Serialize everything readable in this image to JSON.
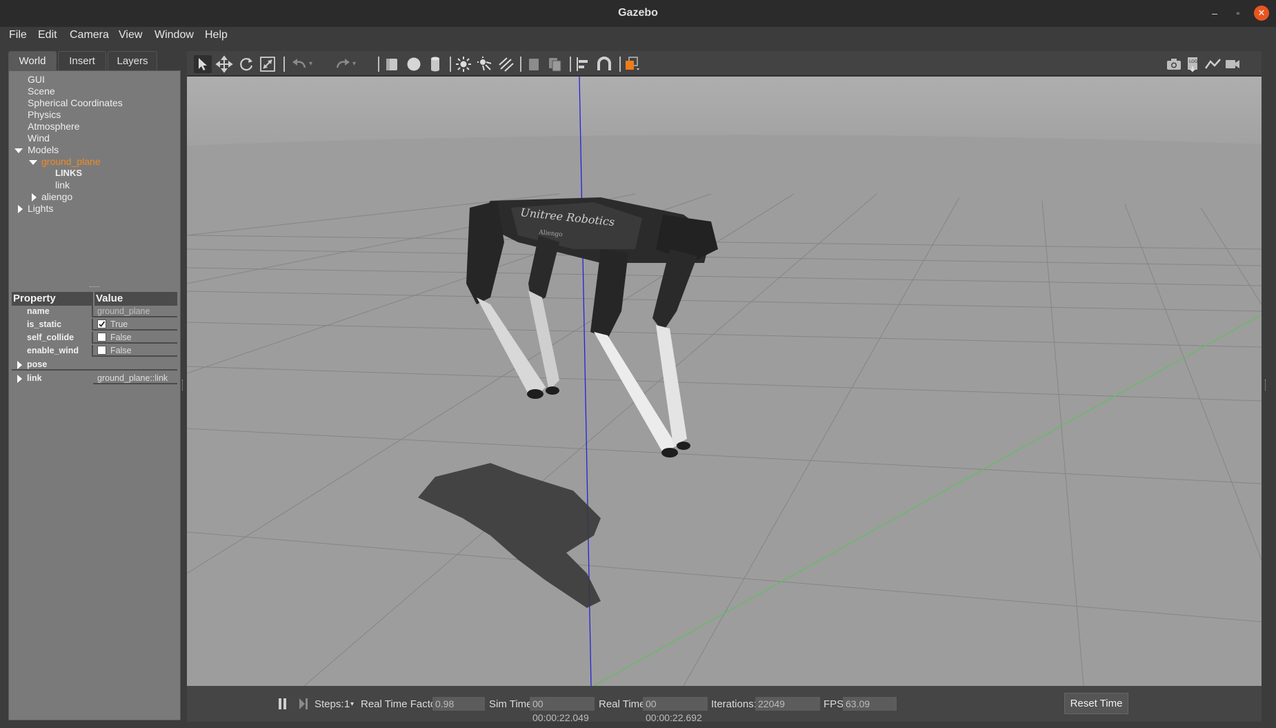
{
  "window": {
    "title": "Gazebo",
    "min_label": "–",
    "max_label": "▫",
    "close_label": "✕",
    "accent": "#e95420"
  },
  "menu": [
    "File",
    "Edit",
    "Camera",
    "View",
    "Window",
    "Help"
  ],
  "tabs": [
    "World",
    "Insert",
    "Layers"
  ],
  "tree": {
    "gui": "GUI",
    "scene": "Scene",
    "spherical": "Spherical Coordinates",
    "physics": "Physics",
    "atmosphere": "Atmosphere",
    "wind": "Wind",
    "models": "Models",
    "ground_plane": "ground_plane",
    "links_header": "LINKS",
    "link": "link",
    "aliengo": "aliengo",
    "lights": "Lights",
    "selected_color": "#f08a24"
  },
  "properties": {
    "header_property": "Property",
    "header_value": "Value",
    "rows": [
      {
        "name": "name",
        "value": "ground_plane"
      },
      {
        "name": "is_static",
        "value": "True",
        "checked": true
      },
      {
        "name": "self_collide",
        "value": "False",
        "checked": false
      },
      {
        "name": "enable_wind",
        "value": "False",
        "checked": false
      },
      {
        "name": "pose",
        "value": ""
      },
      {
        "name": "link",
        "value": "ground_plane::link"
      }
    ]
  },
  "toolbar": {
    "icons": [
      "select-arrow-icon",
      "translate-icon",
      "rotate-icon",
      "scale-icon",
      "undo-icon",
      "redo-icon",
      "box-icon",
      "sphere-icon",
      "cylinder-icon",
      "point-light-icon",
      "spot-light-icon",
      "directional-light-icon",
      "copy-icon",
      "paste-icon",
      "align-icon",
      "snap-icon",
      "view-angle-icon",
      "screenshot-icon",
      "log-icon",
      "plot-icon",
      "video-icon"
    ]
  },
  "scene": {
    "robot_brand": "Unitree Robotics",
    "robot_model": "Aliengo"
  },
  "bottom": {
    "steps_label": "Steps:",
    "steps_value": "1",
    "rtf_label": "Real Time Factor:",
    "rtf_value": "0.98",
    "sim_label": "Sim Time:",
    "sim_value": "00 00:00:22.049",
    "real_label": "Real Time:",
    "real_value": "00 00:00:22.692",
    "iter_label": "Iterations:",
    "iter_value": "22049",
    "fps_label": "FPS:",
    "fps_value": "63.09",
    "reset_label": "Reset Time"
  }
}
